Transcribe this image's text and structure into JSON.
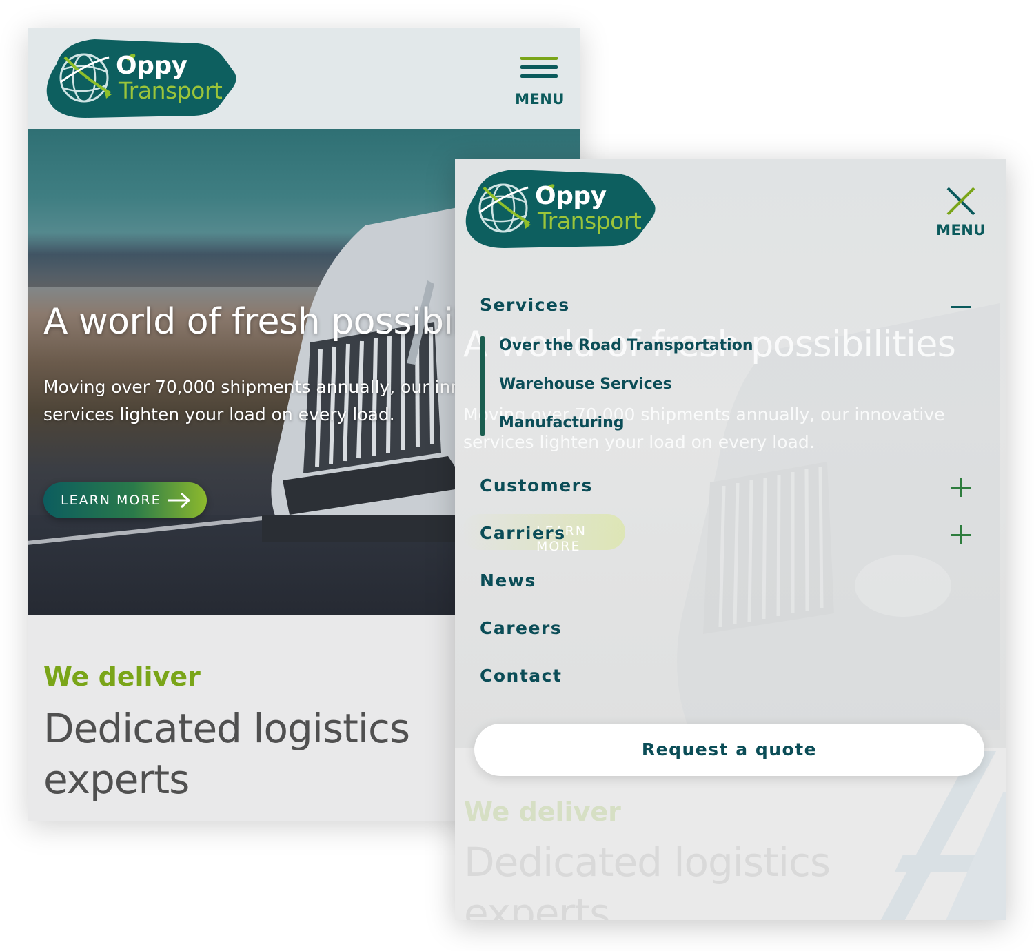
{
  "brand": {
    "name_top": "Oppy",
    "name_bottom": "Transport",
    "colors": {
      "primary": "#0b5a5c",
      "accent": "#7aa519",
      "nav_text": "#0b4d57"
    }
  },
  "header": {
    "menu_label": "MENU",
    "menu_icon": "hamburger-icon",
    "close_icon": "close-icon"
  },
  "hero": {
    "title": "A world of fresh possibilities",
    "subtitle": "Moving over 70,000 shipments annually, our innovative services lighten your load on every load.",
    "cta_label": "LEARN MORE",
    "cta_icon": "arrow-right-icon"
  },
  "intro": {
    "eyebrow": "We deliver",
    "heading": "Dedicated logistics experts"
  },
  "nav": {
    "services": {
      "label": "Services",
      "toggle_icon": "minus-icon",
      "expanded": true,
      "children": [
        "Over the Road Transportation",
        "Warehouse Services",
        "Manufacturing"
      ]
    },
    "customers": {
      "label": "Customers",
      "toggle_icon": "plus-icon"
    },
    "carriers": {
      "label": "Carriers",
      "toggle_icon": "plus-icon"
    },
    "news": {
      "label": "News"
    },
    "careers": {
      "label": "Careers"
    },
    "contact": {
      "label": "Contact"
    },
    "quote_button": "Request a quote"
  }
}
